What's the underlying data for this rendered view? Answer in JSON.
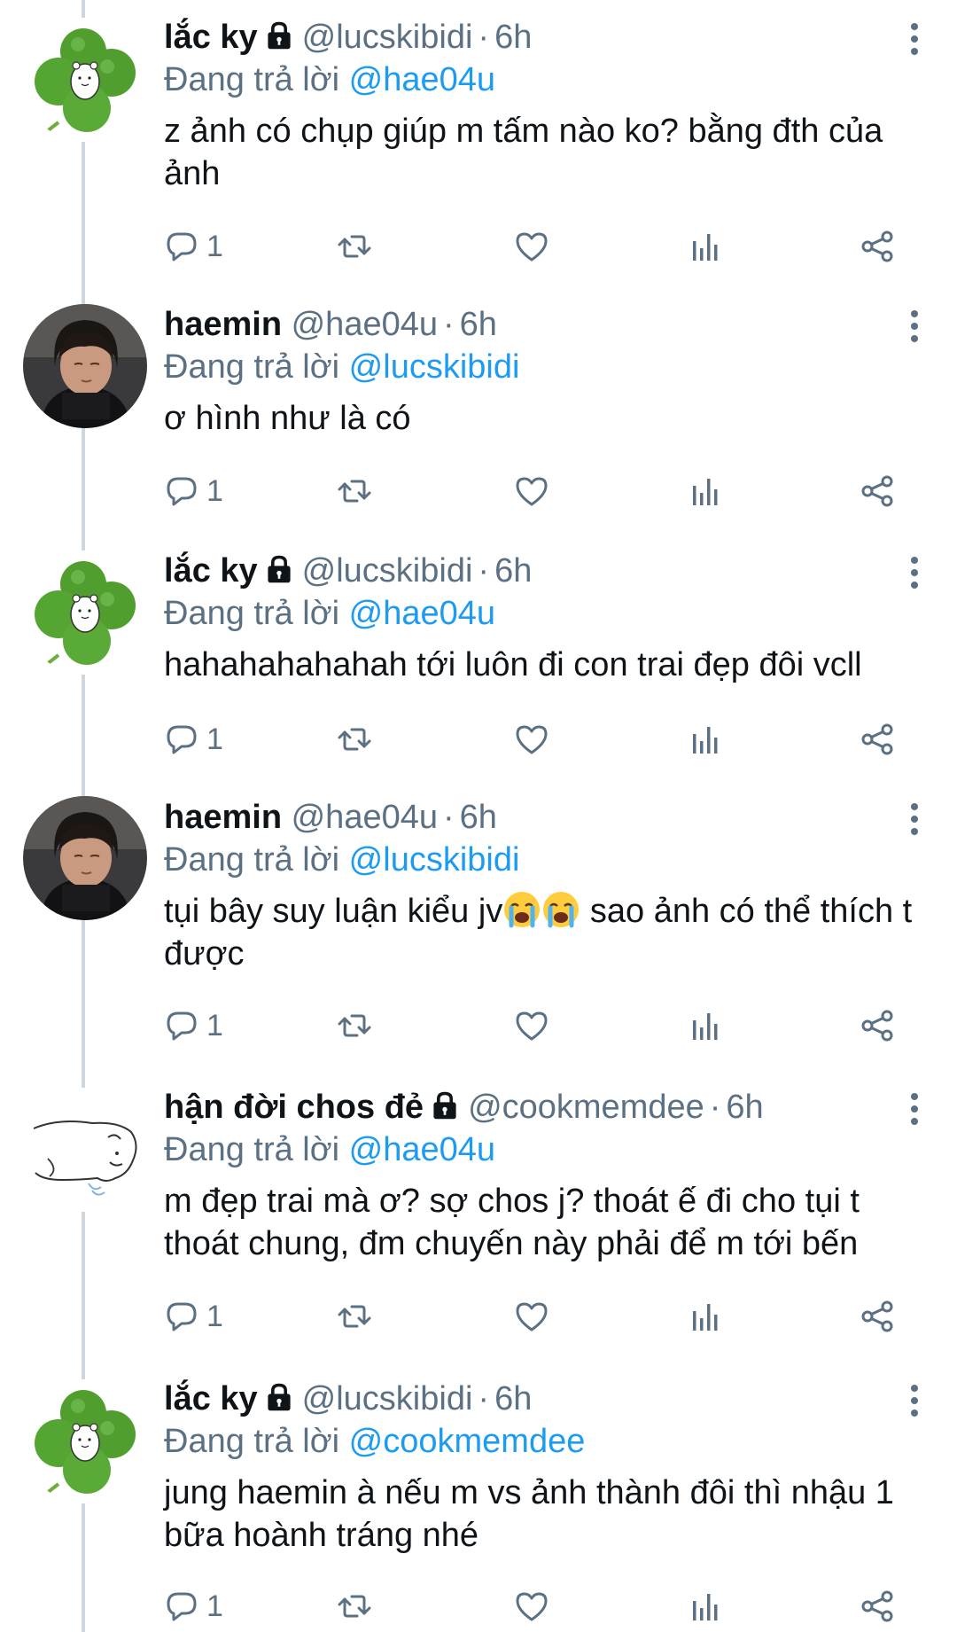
{
  "colors": {
    "link": "#1d9bf0",
    "secondary": "#5b7083",
    "text": "#0f1419",
    "line": "#d0d7dc"
  },
  "tweets": [
    {
      "author": "lắc ky",
      "locked": true,
      "handle": "@lucskibidi",
      "time": "6h",
      "replying_prefix": "Đang trả lời",
      "replying_to": "@hae04u",
      "text": "z ảnh có chụp giúp m tấm nào ko? bằng đth của ảnh",
      "reply_count": "1",
      "avatar": "clover"
    },
    {
      "author": "haemin",
      "locked": false,
      "handle": "@hae04u",
      "time": "6h",
      "replying_prefix": "Đang trả lời",
      "replying_to": "@lucskibidi",
      "text": "ơ hình như là có",
      "reply_count": "1",
      "avatar": "photo"
    },
    {
      "author": "lắc ky",
      "locked": true,
      "handle": "@lucskibidi",
      "time": "6h",
      "replying_prefix": "Đang trả lời",
      "replying_to": "@hae04u",
      "text": "hahahahahahah tới luôn đi con trai đẹp đôi vcll",
      "reply_count": "1",
      "avatar": "clover"
    },
    {
      "author": "haemin",
      "locked": false,
      "handle": "@hae04u",
      "time": "6h",
      "replying_prefix": "Đang trả lời",
      "replying_to": "@lucskibidi",
      "text_before_emoji": "tụi bây suy luận kiểu jv",
      "emoji": "loudly-crying-face-emoji x2",
      "text_after_emoji": " sao ảnh có thể thích t được",
      "reply_count": "1",
      "avatar": "photo"
    },
    {
      "author": "hận đời chos đẻ",
      "locked": true,
      "handle": "@cookmemdee",
      "time": "6h",
      "replying_prefix": "Đang trả lời",
      "replying_to": "@hae04u",
      "text": "m đẹp trai mà ơ? sợ chos j? thoát ế đi cho tụi t thoát chung, đm chuyến này phải để m tới bến",
      "reply_count": "1",
      "avatar": "sketch"
    },
    {
      "author": "lắc ky",
      "locked": true,
      "handle": "@lucskibidi",
      "time": "6h",
      "replying_prefix": "Đang trả lời",
      "replying_to": "@cookmemdee",
      "text": "jung haemin à nếu m vs ảnh thành đôi thì nhậu 1 bữa hoành tráng nhé",
      "reply_count": "1",
      "avatar": "clover"
    }
  ],
  "icons": {
    "reply": "reply-icon",
    "retweet": "retweet-icon",
    "like": "heart-icon",
    "stats": "analytics-icon",
    "share": "share-icon",
    "more": "more-options-icon",
    "lock": "lock-icon"
  }
}
